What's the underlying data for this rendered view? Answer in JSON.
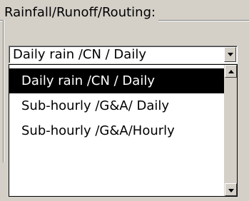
{
  "group": {
    "title": "Rainfall/Runoff/Routing:"
  },
  "combo": {
    "selected": "Daily rain /CN / Daily",
    "button_icon": "chevron-down-icon"
  },
  "dropdown": {
    "options": [
      {
        "label": "Daily rain /CN / Daily",
        "selected": true
      },
      {
        "label": "Sub-hourly /G&A/ Daily",
        "selected": false
      },
      {
        "label": "Sub-hourly /G&A/Hourly",
        "selected": false
      }
    ]
  },
  "scrollbar": {
    "up_icon": "chevron-up-icon",
    "down_icon": "chevron-down-icon"
  },
  "colors": {
    "face": "#d4d0c8",
    "selection": "#000000",
    "selection_text": "#ffffff",
    "window": "#ffffff"
  }
}
